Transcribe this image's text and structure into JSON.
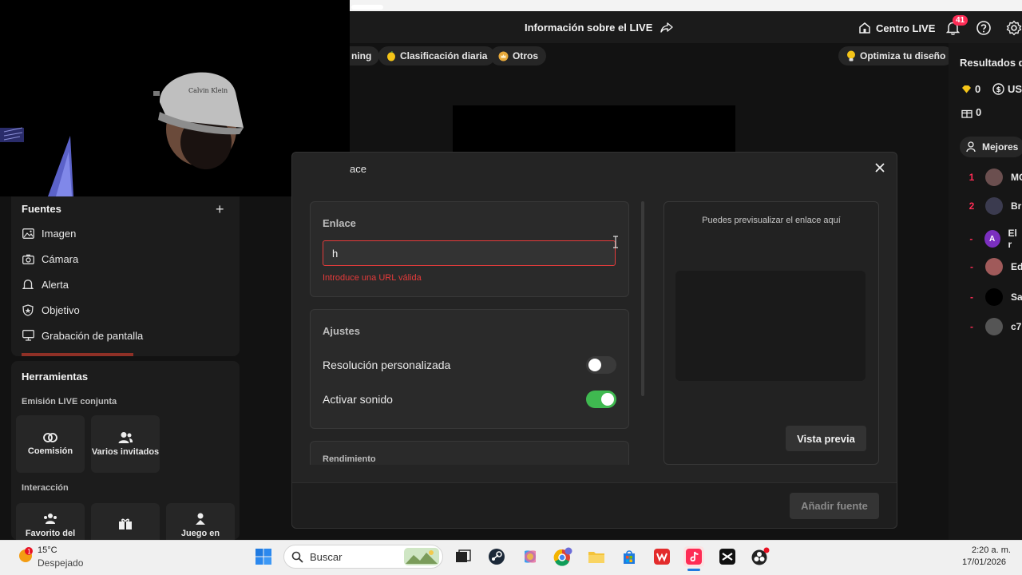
{
  "header": {
    "live_info": "Información sobre el LIVE",
    "centro_live": "Centro LIVE",
    "notifications_count": "41"
  },
  "chips": {
    "trending": "ning",
    "daily": "Clasificación diaria",
    "otros": "Otros",
    "optimize": "Optimiza tu diseño"
  },
  "webcam": {
    "cap_text": "Calvin Klein"
  },
  "sources": {
    "title": "Fuentes",
    "items": [
      {
        "label": "Imagen",
        "icon": "image-icon"
      },
      {
        "label": "Cámara",
        "icon": "camera-icon"
      },
      {
        "label": "Alerta",
        "icon": "bell-icon"
      },
      {
        "label": "Objetivo",
        "icon": "goal-shield-icon"
      },
      {
        "label": "Grabación de pantalla",
        "icon": "monitor-icon"
      }
    ]
  },
  "tools": {
    "title": "Herramientas",
    "joint_live": "Emisión LIVE conjunta",
    "coemision": "Coemisión",
    "varios_invitados": "Varios invitados",
    "interaccion": "Interacción",
    "favorito": "Favorito del",
    "juego": "Juego en"
  },
  "right_panel": {
    "title": "Resultados de",
    "diamonds": "0",
    "usd_label": "US",
    "gifts": "0",
    "mejores": "Mejores",
    "rank": [
      {
        "num": "1",
        "name": "MO",
        "color": "#6b4f4f"
      },
      {
        "num": "2",
        "name": "Bri",
        "color": "#3b3b4f"
      },
      {
        "num": "-",
        "name": "El r",
        "color": "#7b2fbf",
        "initial": "A"
      },
      {
        "num": "-",
        "name": "Ed",
        "color": "#a05a5a"
      },
      {
        "num": "-",
        "name": "Sa",
        "color": "#000000"
      },
      {
        "num": "-",
        "name": "c7",
        "color": "#555555"
      }
    ]
  },
  "modal": {
    "title": "ace",
    "enlace_label": "Enlace",
    "url_value": "h",
    "url_error": "Introduce una URL válida",
    "ajustes_label": "Ajustes",
    "resolucion_label": "Resolución personalizada",
    "resolucion_on": false,
    "sonido_label": "Activar sonido",
    "sonido_on": true,
    "rendimiento_label": "Rendimiento",
    "preview_hint": "Puedes previsualizar el enlace aquí",
    "preview_button": "Vista previa",
    "add_button": "Añadir fuente"
  },
  "taskbar": {
    "weather_temp": "15°C",
    "weather_desc": "Despejado",
    "weather_badge": "1",
    "search_placeholder": "Buscar",
    "time": "2:20 a. m.",
    "date": "17/01/2026"
  },
  "colors": {
    "accent_red": "#fe2c55",
    "error_red": "#e53b3b",
    "toggle_green": "#3fb950"
  }
}
